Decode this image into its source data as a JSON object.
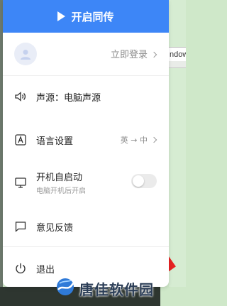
{
  "header": {
    "start_label": "开启同传"
  },
  "account": {
    "login_label": "立即登录"
  },
  "menu": {
    "audio_source": "声源：电脑声源",
    "language_settings": "语言设置",
    "language_value": "英 → 中",
    "autostart_label": "开机自启动",
    "autostart_desc": "电脑开机后开启",
    "autostart_enabled": false,
    "feedback": "意见反馈",
    "exit": "退出"
  },
  "background": {
    "window_chip_text": "ndow"
  },
  "watermark": {
    "text": "唐佳软件园"
  },
  "colors": {
    "accent": "#3d86f7",
    "toggle_off": "#ebebeb",
    "cursor": "#e62222"
  },
  "icons": [
    "play-icon",
    "avatar-icon",
    "speaker-icon",
    "language-icon",
    "monitor-icon",
    "feedback-icon",
    "power-icon",
    "chevron-right-icon"
  ]
}
